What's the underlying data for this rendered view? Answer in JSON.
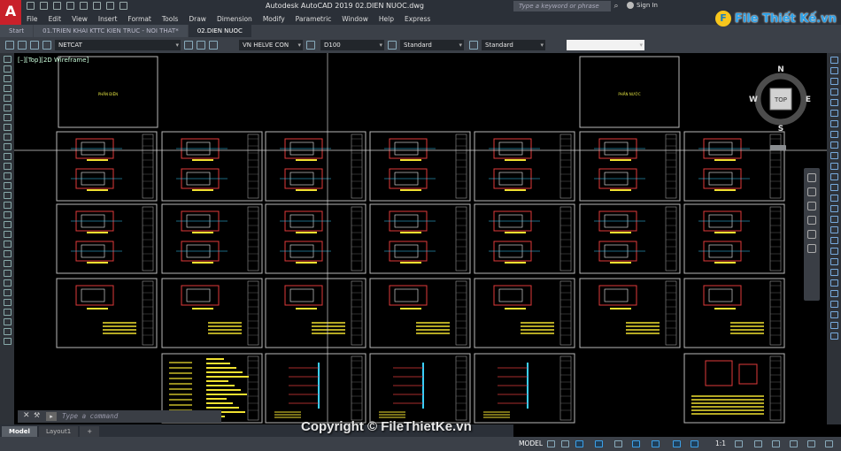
{
  "app": {
    "logo_letter": "A",
    "window_title": "Autodesk AutoCAD 2019    02.DIEN NUOC.dwg",
    "search_placeholder": "Type a keyword or phrase",
    "sign_in": "Sign In",
    "help_icon": "?"
  },
  "menu": [
    "File",
    "Edit",
    "View",
    "Insert",
    "Format",
    "Tools",
    "Draw",
    "Dimension",
    "Modify",
    "Parametric",
    "Window",
    "Help",
    "Express"
  ],
  "tabs": [
    {
      "label": "Start",
      "active": false
    },
    {
      "label": "01.TRIEN KHAI KTTC KIEN TRUC - NOI THAT*",
      "active": false
    },
    {
      "label": "02.DIEN NUOC",
      "active": true
    }
  ],
  "properties": {
    "layer": "NETCAT",
    "text_style": "VN HELVE CON",
    "dim_style": "D100",
    "table_style": "Standard",
    "multileader_style": "Standard"
  },
  "viewport": {
    "label": "[–][Top][2D Wireframe]"
  },
  "sheets": {
    "title_left": "PHẦN ĐIỆN",
    "title_right": "PHẦN NƯỚC"
  },
  "viewcube": {
    "north": "N",
    "south": "S",
    "east": "E",
    "west": "W",
    "face": "TOP"
  },
  "command": {
    "placeholder": "Type a command",
    "close_icon": "✕",
    "prompt_icon": "▸"
  },
  "layouts": [
    "Model",
    "Layout1",
    "+"
  ],
  "status": {
    "model": "MODEL",
    "scale": "1:1"
  },
  "brand": {
    "badge": "F",
    "text": "File Thiết Kế.vn"
  },
  "watermark": "Copyright © FileThietKe.vn"
}
